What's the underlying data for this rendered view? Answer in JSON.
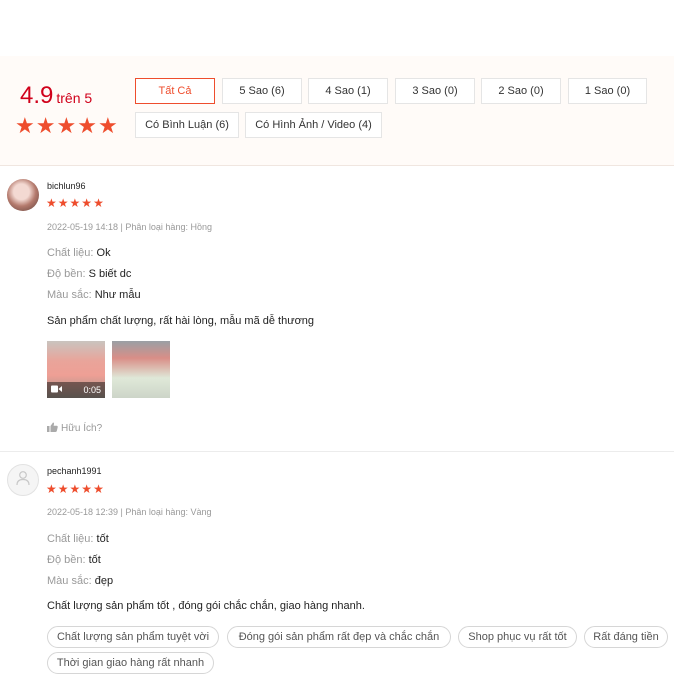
{
  "summary": {
    "score": "4.9",
    "score_suffix": "trên 5",
    "filters": [
      {
        "label": "Tất Cả",
        "active": true
      },
      {
        "label": "5 Sao (6)"
      },
      {
        "label": "4 Sao (1)"
      },
      {
        "label": "3 Sao (0)"
      },
      {
        "label": "2 Sao (0)"
      },
      {
        "label": "1 Sao (0)"
      },
      {
        "label": "Có Bình Luận (6)"
      },
      {
        "label": "Có Hình Ảnh / Video (4)"
      }
    ],
    "rating": 5
  },
  "reviews": [
    {
      "username": "bichlun96",
      "rating": 5,
      "meta": "2022-05-19 14:18 | Phân loại hàng: Hồng",
      "attributes": [
        {
          "key": "Chất liệu:",
          "value": "Ok"
        },
        {
          "key": "Độ bền:",
          "value": "S biết dc"
        },
        {
          "key": "Màu sắc:",
          "value": "Như mẫu"
        }
      ],
      "content": "Sản phẩm chất lượng, rất hài lòng, mẫu mã dễ thương",
      "video_duration": "0:05",
      "helpful_label": "Hữu Ích?"
    },
    {
      "username": "pechanh1991",
      "rating": 5,
      "meta": "2022-05-18 12:39 | Phân loại hàng: Vàng",
      "attributes": [
        {
          "key": "Chất liệu:",
          "value": "tốt"
        },
        {
          "key": "Độ bền:",
          "value": "tốt"
        },
        {
          "key": "Màu sắc:",
          "value": "đẹp"
        }
      ],
      "content": "Chất lượng sản phẩm tốt , đóng gói chắc chắn, giao hàng nhanh.",
      "tags": [
        "Chất lượng sản phẩm tuyệt vời",
        "Đóng gói sản phẩm rất đẹp và chắc chắn",
        "Shop phục vụ rất tốt",
        "Rất đáng tiền",
        "Thời gian giao hàng rất nhanh"
      ]
    }
  ],
  "colors": {
    "accent": "#ee4d2d",
    "score": "#d0011b"
  },
  "icons": {
    "star": "star-icon",
    "video": "video-camera-icon",
    "thumb": "thumbs-up-icon",
    "user": "user-icon"
  }
}
